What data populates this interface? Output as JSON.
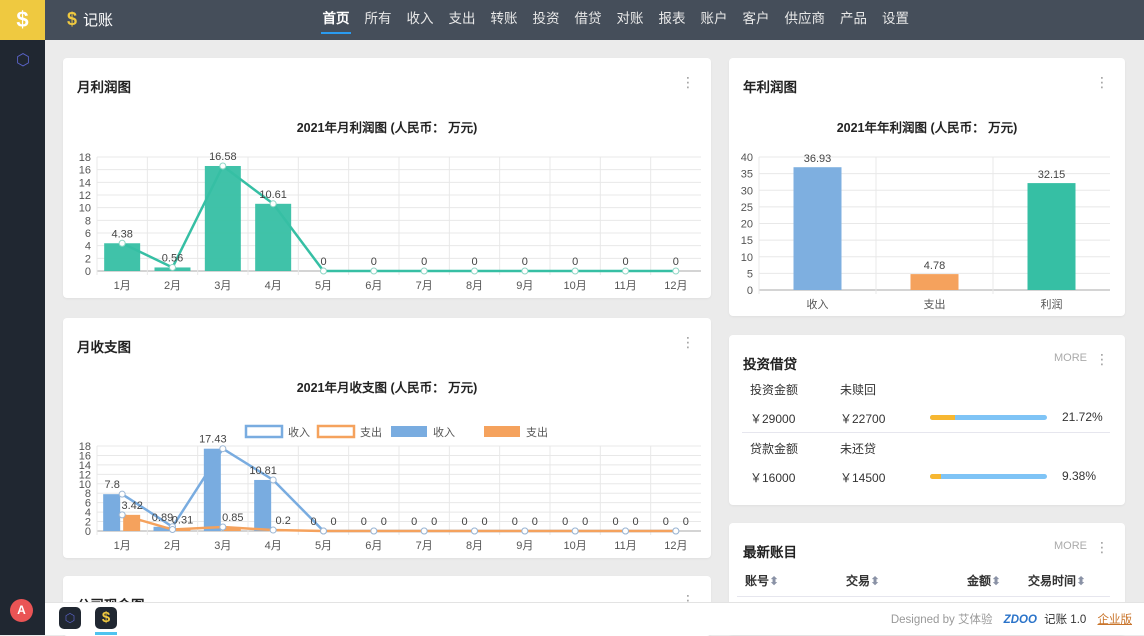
{
  "app": {
    "logo": "$",
    "name": "记账",
    "avatar": "A"
  },
  "nav": [
    "首页",
    "所有",
    "收入",
    "支出",
    "转账",
    "投资",
    "借贷",
    "对账",
    "报表",
    "账户",
    "客户",
    "供应商",
    "产品",
    "设置"
  ],
  "cards": {
    "monthly_profit": {
      "title": "月利润图"
    },
    "monthly_inout": {
      "title": "月收支图"
    },
    "cash": {
      "title": "公司现金图"
    },
    "annual_profit": {
      "title": "年利润图"
    },
    "invest": {
      "title": "投资借贷",
      "more": "MORE",
      "rows": [
        {
          "label1": "投资金额",
          "label2": "未赎回",
          "v1": "￥29000",
          "v2": "￥22700",
          "pct": "21.72%",
          "fill": 21.72
        },
        {
          "label1": "贷款金额",
          "label2": "未还贷",
          "v1": "￥16000",
          "v2": "￥14500",
          "pct": "9.38%",
          "fill": 9.38
        }
      ]
    },
    "latest": {
      "title": "最新账目",
      "more": "MORE",
      "cols": [
        "账号",
        "交易",
        "金额",
        "交易时间"
      ]
    }
  },
  "chart_data": [
    {
      "type": "bar+line",
      "title": "2021年月利润图 (人民币： 万元)",
      "categories": [
        "1月",
        "2月",
        "3月",
        "4月",
        "5月",
        "6月",
        "7月",
        "8月",
        "9月",
        "10月",
        "11月",
        "12月"
      ],
      "values": [
        4.38,
        0.56,
        16.58,
        10.61,
        0,
        0,
        0,
        0,
        0,
        0,
        0,
        0
      ],
      "ylim": [
        0,
        18
      ],
      "yticks": [
        0,
        2,
        4,
        6,
        8,
        10,
        12,
        14,
        16,
        18
      ],
      "color": "#36bfa4"
    },
    {
      "type": "bar+line",
      "title": "2021年月收支图 (人民币： 万元)",
      "categories": [
        "1月",
        "2月",
        "3月",
        "4月",
        "5月",
        "6月",
        "7月",
        "8月",
        "9月",
        "10月",
        "11月",
        "12月"
      ],
      "legend": [
        "收入",
        "支出",
        "收入",
        "支出"
      ],
      "series": [
        {
          "name": "收入",
          "values": [
            7.8,
            0.89,
            17.43,
            10.81,
            0,
            0,
            0,
            0,
            0,
            0,
            0,
            0
          ],
          "color": "#79ace0"
        },
        {
          "name": "支出",
          "values": [
            3.42,
            0.31,
            0.85,
            0.2,
            0,
            0,
            0,
            0,
            0,
            0,
            0,
            0
          ],
          "color": "#f5a25d"
        }
      ],
      "ylim": [
        0,
        18
      ],
      "yticks": [
        0,
        2,
        4,
        6,
        8,
        10,
        12,
        14,
        16,
        18
      ]
    },
    {
      "type": "bar",
      "title": "2021年年利润图 (人民币： 万元)",
      "categories": [
        "收入",
        "支出",
        "利润"
      ],
      "values": [
        36.93,
        4.78,
        32.15
      ],
      "colors": [
        "#7eafe0",
        "#f5a25d",
        "#36bfa4"
      ],
      "ylim": [
        0,
        40
      ],
      "yticks": [
        0,
        5,
        10,
        15,
        20,
        25,
        30,
        35,
        40
      ]
    }
  ],
  "footer": {
    "designed": "Designed by 艾体验",
    "brand": "ZDOO",
    "product": "记账 1.0",
    "edition": "企业版"
  }
}
